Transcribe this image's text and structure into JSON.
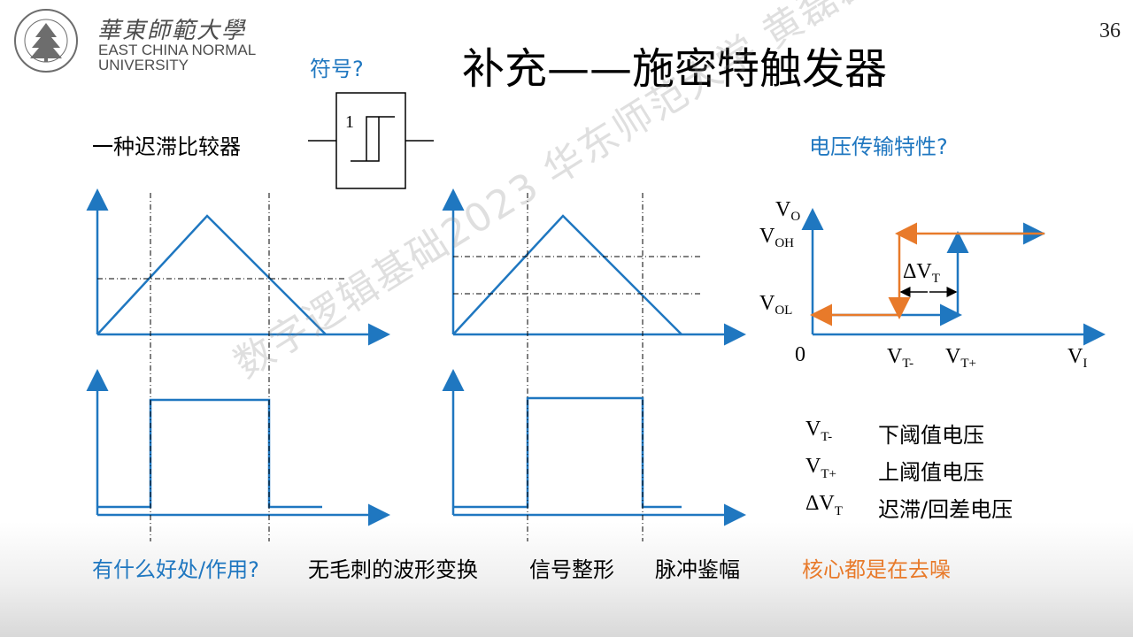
{
  "header": {
    "logo_cn": "華東師範大學",
    "logo_en_line1": "EAST CHINA NORMAL",
    "logo_en_line2": "UNIVERSITY",
    "seal_text": "EAST CHINA NORMAL UNIVERSITY",
    "page_number": "36"
  },
  "title": "补充——施密特触发器",
  "symbol_question": "符号?",
  "symbol_label": "1",
  "definition": "一种迟滞比较器",
  "vtc_question": "电压传输特性?",
  "vtc": {
    "vo_label": "V",
    "vo_sub": "O",
    "voh_label": "V",
    "voh_sub": "OH",
    "vol_label": "V",
    "vol_sub": "OL",
    "origin": "0",
    "vtminus_label": "V",
    "vtminus_sub": "T-",
    "vtplus_label": "V",
    "vtplus_sub": "T+",
    "vi_label": "V",
    "vi_sub": "I",
    "dvt_label": "ΔV",
    "dvt_sub": "T"
  },
  "legend": [
    {
      "sym": "V",
      "sub": "T-",
      "desc": "下阈值电压"
    },
    {
      "sym": "V",
      "sub": "T+",
      "desc": "上阈值电压"
    },
    {
      "sym": "ΔV",
      "sub": "T",
      "desc": "迟滞/回差电压"
    }
  ],
  "bottom": {
    "question": "有什么好处/作用?",
    "item1": "无毛刺的波形变换",
    "item2": "信号整形",
    "item3": "脉冲鉴幅",
    "conclusion": "核心都是在去噪"
  },
  "watermark": "数字逻辑基础2023 华东师范大学 黄磊磊",
  "colors": {
    "blue": "#1f77c0",
    "orange": "#e87a2a",
    "blue_text": "#1f77c0"
  }
}
